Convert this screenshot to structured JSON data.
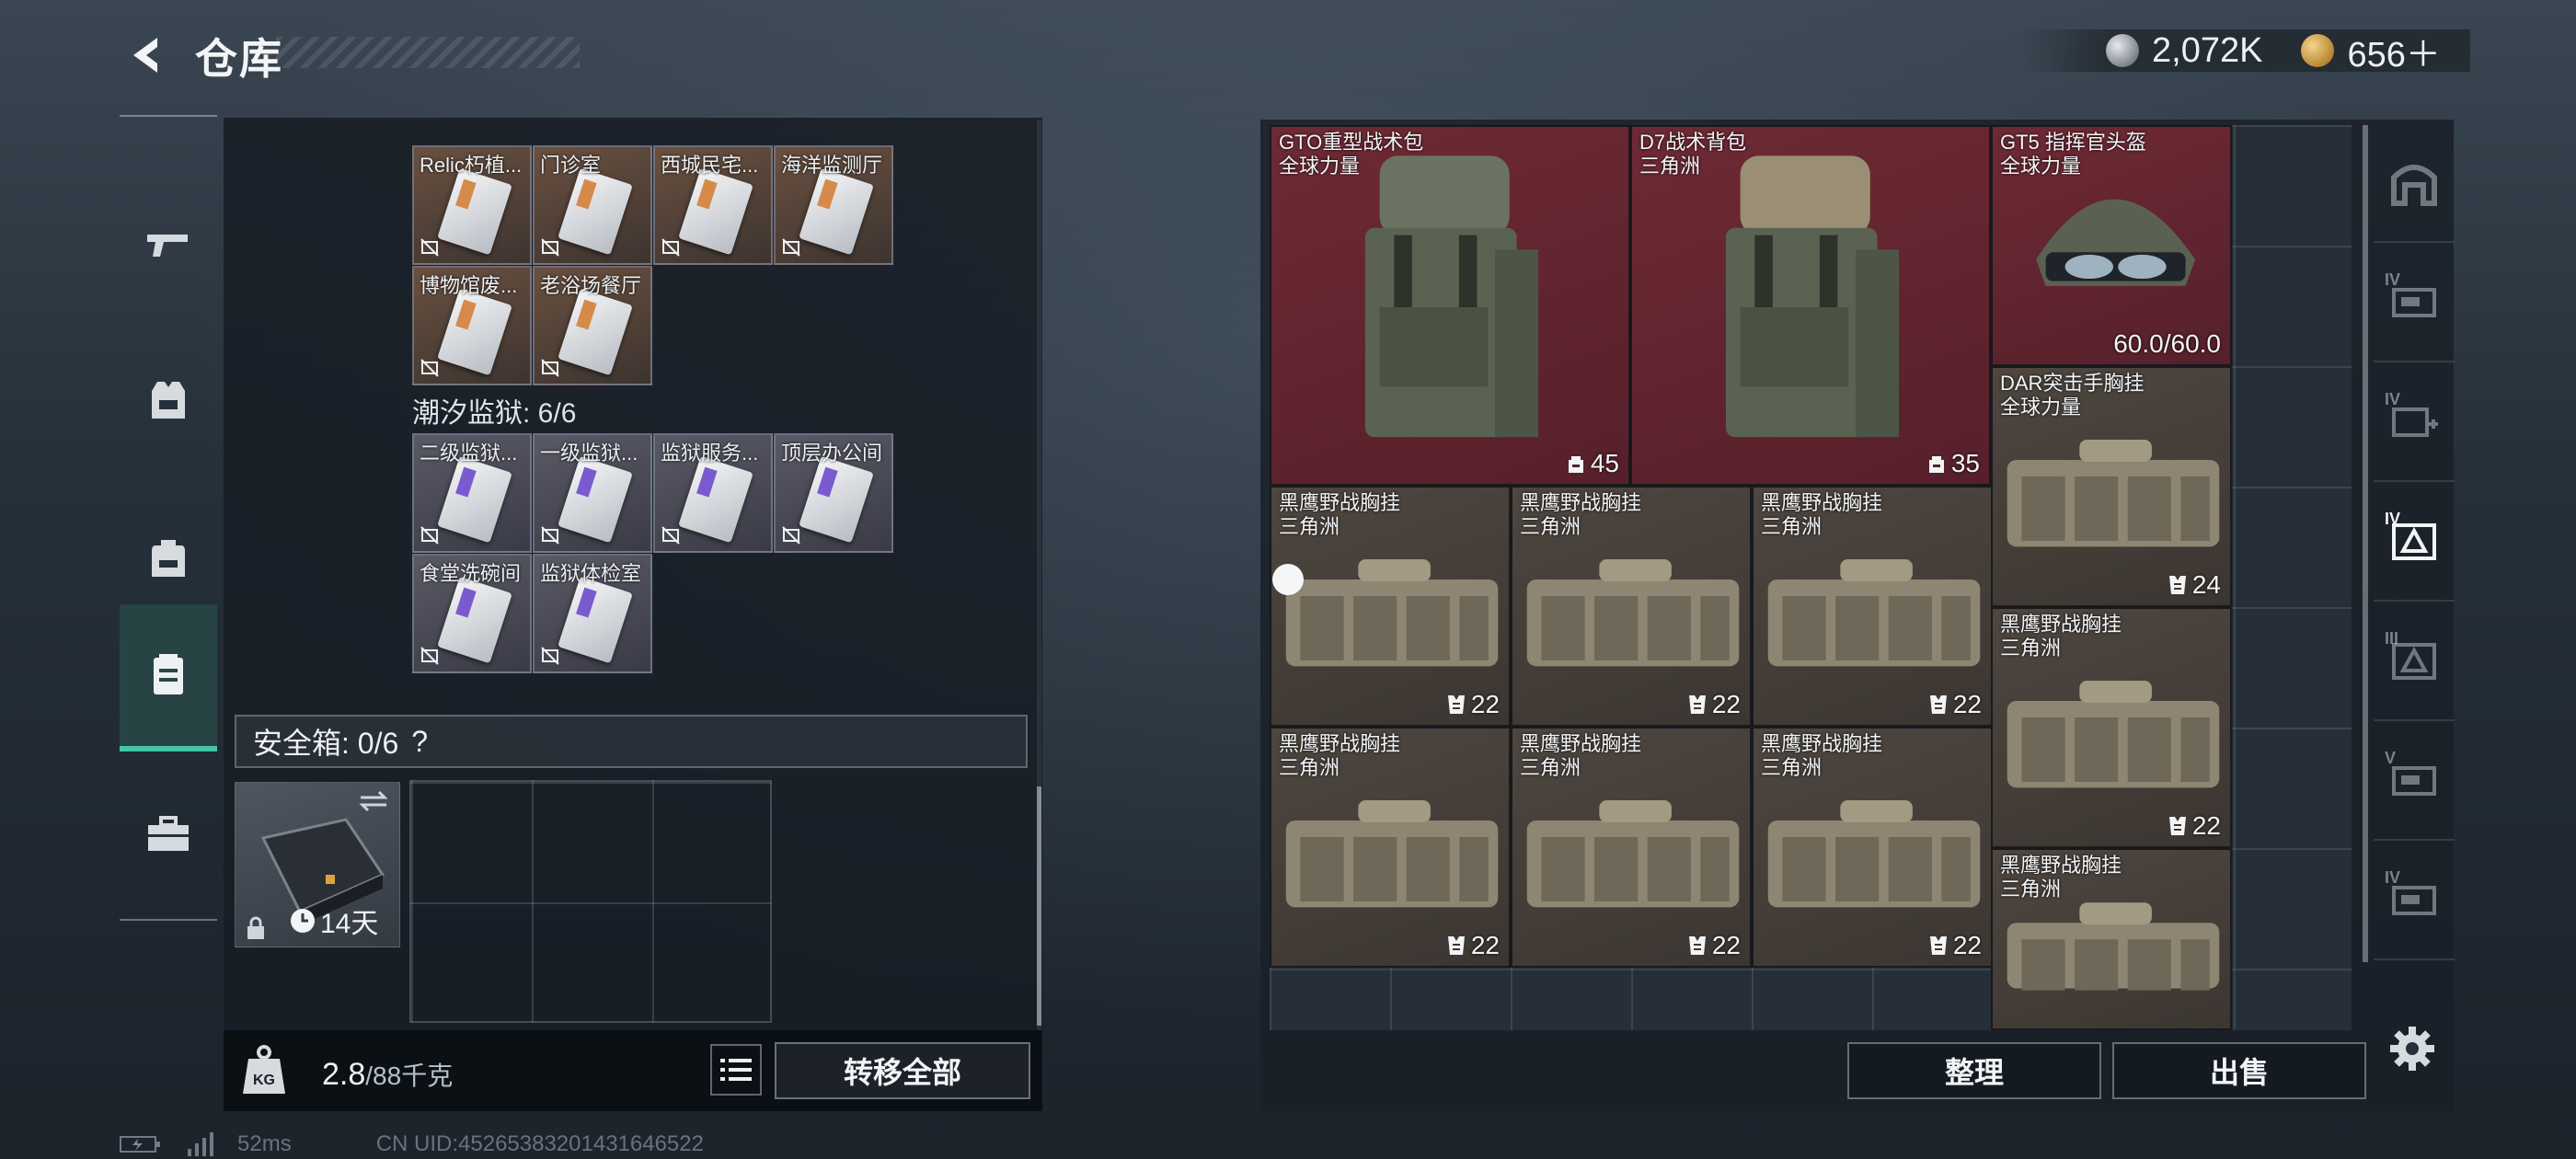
{
  "header": {
    "title": "仓库",
    "currencies": [
      {
        "icon": "silver-coin-icon",
        "value": "2,072K"
      },
      {
        "icon": "gold-coin-icon",
        "value": "656＋"
      }
    ]
  },
  "left_nav": [
    {
      "icon": "weapon-icon",
      "active": false
    },
    {
      "icon": "armor-vest-icon",
      "active": false
    },
    {
      "icon": "backpack-icon",
      "active": false
    },
    {
      "icon": "keycard-icon",
      "active": true
    },
    {
      "icon": "toolbox-icon",
      "active": false
    }
  ],
  "keys_panel": {
    "group1_cards": [
      {
        "label": "Relic朽植...",
        "tint": "orange"
      },
      {
        "label": "门诊室",
        "tint": "orange"
      },
      {
        "label": "西城民宅...",
        "tint": "orange"
      },
      {
        "label": "海洋监测厅",
        "tint": "orange"
      },
      {
        "label": "博物馆废...",
        "tint": "orange"
      },
      {
        "label": "老浴场餐厅",
        "tint": "orange"
      }
    ],
    "group2_title": "潮汐监狱: 6/6",
    "group2_cards": [
      {
        "label": "二级监狱...",
        "tint": "purple"
      },
      {
        "label": "一级监狱...",
        "tint": "purple"
      },
      {
        "label": "监狱服务...",
        "tint": "purple"
      },
      {
        "label": "顶层办公间",
        "tint": "purple"
      },
      {
        "label": "食堂洗碗间",
        "tint": "purple"
      },
      {
        "label": "监狱体检室",
        "tint": "purple"
      }
    ]
  },
  "safebox": {
    "title": "安全箱: 0/6",
    "help": "?",
    "duration": "14天"
  },
  "bottom_bar": {
    "weight_value": "2.8",
    "weight_cap": "/88千克",
    "transfer_all": "转移全部"
  },
  "status_bar": {
    "ping": "52ms",
    "uid": "CN UID:452653832014316465​22"
  },
  "storage_items": [
    {
      "name": "GTO重型战术包",
      "sub": "全球力量",
      "badge": "45",
      "badge_icon": "capacity-icon",
      "tint": "red"
    },
    {
      "name": "D7战术背包",
      "sub": "三角洲",
      "badge": "35",
      "badge_icon": "capacity-icon",
      "tint": "red"
    },
    {
      "name": "GT5 指挥官头盔",
      "sub": "全球力量",
      "durability": "60.0/60.0",
      "tint": "red"
    },
    {
      "name": "DAR突击手胸挂",
      "sub": "全球力量",
      "badge": "24",
      "badge_icon": "vest-slot-icon",
      "tint": "brown"
    },
    {
      "name": "黑鹰野战胸挂",
      "sub": "三角洲",
      "badge": "22",
      "badge_icon": "vest-slot-icon",
      "tint": "brown"
    },
    {
      "name": "黑鹰野战胸挂",
      "sub": "三角洲",
      "badge": "22",
      "badge_icon": "vest-slot-icon",
      "tint": "brown"
    },
    {
      "name": "黑鹰野战胸挂",
      "sub": "三角洲",
      "badge": "22",
      "badge_icon": "vest-slot-icon",
      "tint": "brown"
    },
    {
      "name": "黑鹰野战胸挂",
      "sub": "三角洲",
      "badge": "22",
      "badge_icon": "vest-slot-icon",
      "tint": "brown"
    },
    {
      "name": "黑鹰野战胸挂",
      "sub": "三角洲",
      "badge": "22",
      "badge_icon": "vest-slot-icon",
      "tint": "brown"
    },
    {
      "name": "黑鹰野战胸挂",
      "sub": "三角洲",
      "badge": "22",
      "badge_icon": "vest-slot-icon",
      "tint": "brown"
    },
    {
      "name": "黑鹰野战胸挂",
      "sub": "三角洲",
      "badge": "22",
      "badge_icon": "vest-slot-icon",
      "tint": "brown"
    },
    {
      "name": "黑鹰野战胸挂",
      "sub": "三角洲",
      "tint": "brown"
    }
  ],
  "right_nav": [
    {
      "icon": "storage-home-icon",
      "level": ""
    },
    {
      "icon": "weapon-case-icon",
      "level": "IV"
    },
    {
      "icon": "medical-case-icon",
      "level": "IV"
    },
    {
      "icon": "key-case-icon",
      "level": "IV",
      "active": true
    },
    {
      "icon": "key-case-icon",
      "level": "III"
    },
    {
      "icon": "ammo-case-icon",
      "level": "V"
    },
    {
      "icon": "gear-case-icon",
      "level": "IV"
    }
  ],
  "actions": {
    "sort": "整理",
    "sell": "出售"
  },
  "colors": {
    "accent": "#44c5a5",
    "rare_red": "#6e2a34",
    "item_brown": "#4e463f"
  }
}
